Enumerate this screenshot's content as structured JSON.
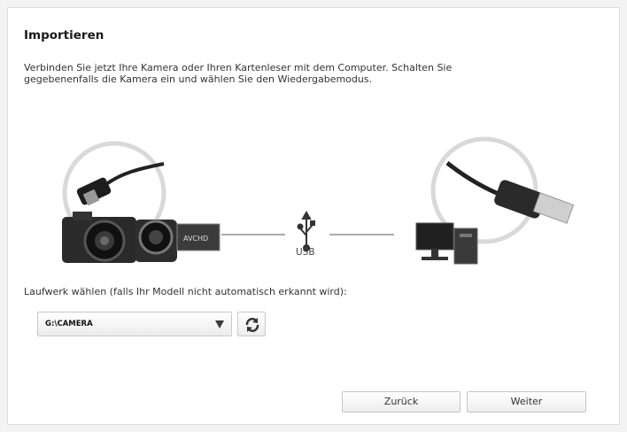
{
  "header": {
    "title": "Importieren",
    "description": "Verbinden Sie jetzt Ihre Kamera oder Ihren Kartenleser mit dem Computer. Schalten Sie gegebenenfalls die Kamera ein und wählen Sie den Wiedergabemodus."
  },
  "illustration": {
    "usb_label": "USB",
    "camcorder_badge": "AVCHD",
    "icons": [
      "mini-usb-plug-icon",
      "photo-camera-icon",
      "camcorder-icon",
      "usb-symbol-icon",
      "usb-a-plug-icon",
      "desktop-computer-icon"
    ]
  },
  "drive": {
    "label": "Laufwerk wählen (falls Ihr Modell nicht automatisch erkannt wird):",
    "selected": "G:\\CAMERA"
  },
  "buttons": {
    "back": "Zurück",
    "next": "Weiter"
  }
}
